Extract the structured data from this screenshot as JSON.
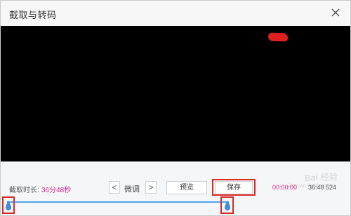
{
  "window": {
    "title": "截取与转码"
  },
  "controls": {
    "duration_label": "截取时长:",
    "duration_value": "36分48秒",
    "prev_label": "<",
    "finetune_label": "微调",
    "next_label": ">",
    "preview_label": "预览",
    "save_label": "保存",
    "time_start": "00:00:00",
    "time_end": "36:48 524"
  },
  "timeline": {
    "start_fraction": 0.0,
    "end_fraction": 1.0
  },
  "watermark": {
    "brand": "Bai 经验",
    "url": "jingyan.baidu.com"
  },
  "colors": {
    "accent": "#4da3e8",
    "highlight": "#d82b2b",
    "time_text": "#d6288a"
  },
  "icons": {
    "close": "close-icon",
    "handle": "droplet-handle-icon"
  }
}
